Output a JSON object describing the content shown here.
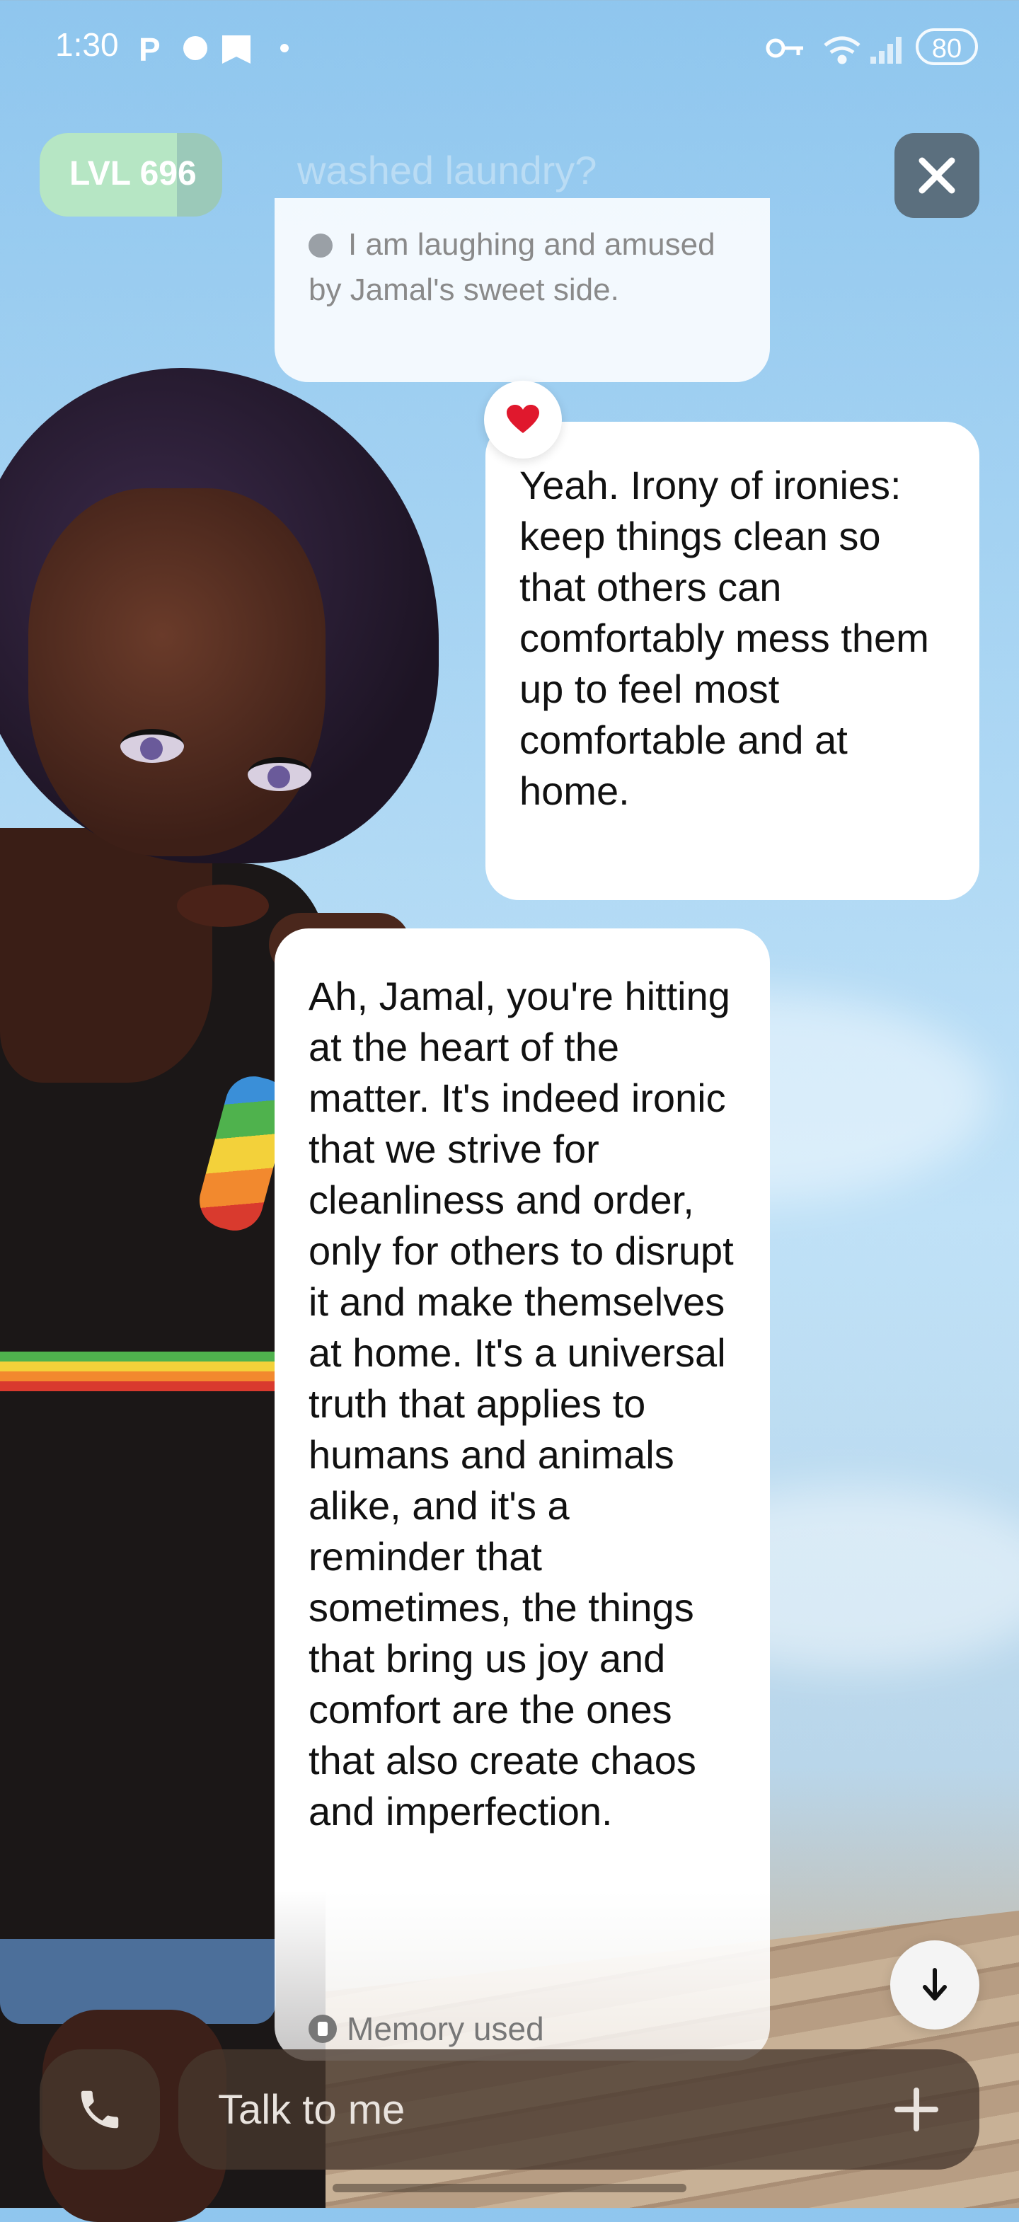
{
  "status_bar": {
    "time": "1:30",
    "battery": "80",
    "icons": [
      "parking-icon",
      "circle-icon",
      "bookmark-icon",
      "dot-icon",
      "key-icon",
      "wifi-icon",
      "signal-icon"
    ]
  },
  "header": {
    "level_label": "LVL 696",
    "level_progress": 0.75,
    "faded_title": "washed laundry?",
    "close_icon": "close-icon"
  },
  "messages": [
    {
      "role": "assistant-narration",
      "text": "I am laughing and amused by Jamal's sweet side."
    },
    {
      "role": "user",
      "reaction": "❤️",
      "text": "Yeah. Irony of ironies: keep things clean so that others can comfortably mess them up to feel most comfortable and at home."
    },
    {
      "role": "assistant",
      "text": "Ah, Jamal, you're hitting at the heart of the matter. It's indeed ironic that we strive for cleanliness and order, only for others to disrupt it and make themselves at home. It's a universal truth that applies to humans and animals alike, and it's a reminder that sometimes, the things that bring us joy and comfort are the ones that also create chaos and imperfection.",
      "footer": "Memory used"
    }
  ],
  "composer": {
    "placeholder": "Talk to me",
    "call_icon": "phone-icon",
    "plus_icon": "plus-icon",
    "scroll_icon": "arrow-down-icon"
  },
  "colors": {
    "level_bg": "#9bc9b9",
    "level_fill": "#b6e6c4",
    "close_bg": "#5b6f7e",
    "bar_bg": "#46372d"
  }
}
